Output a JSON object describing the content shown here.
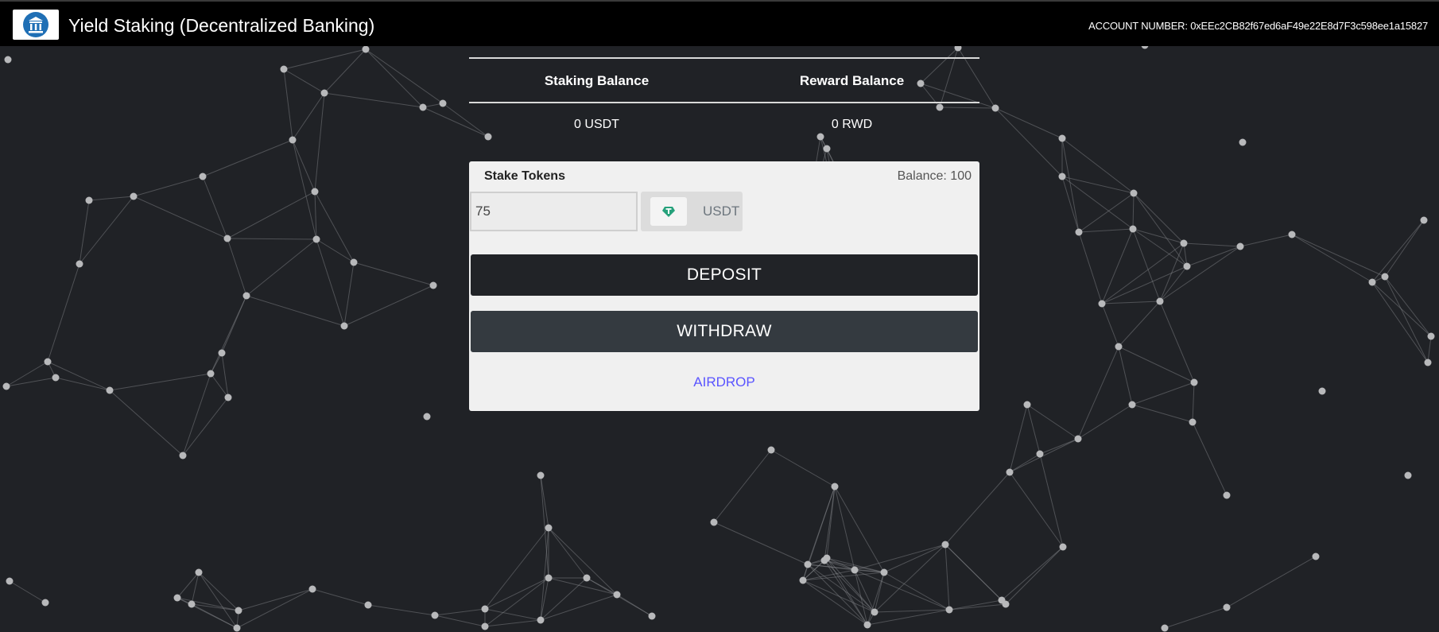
{
  "navbar": {
    "title": "Yield Staking (Decentralized Banking)",
    "account_label": "ACCOUNT NUMBER:",
    "account_number": "0xEEc2CB82f67ed6aF49e22E8d7F3c598ee1a15827",
    "logo_icon": "bank-icon"
  },
  "balances": {
    "staking_header": "Staking Balance",
    "reward_header": "Reward Balance",
    "staking_value": "0 USDT",
    "reward_value": "0 RWD"
  },
  "stake_card": {
    "label": "Stake Tokens",
    "balance_text": "Balance: 100",
    "amount_value": "75",
    "token_name": "USDT",
    "token_icon": "tether-icon",
    "deposit_label": "DEPOSIT",
    "withdraw_label": "WITHDRAW",
    "airdrop_label": "AIRDROP"
  },
  "colors": {
    "background": "#202226",
    "navbar": "#000000",
    "card": "#f0f0f0",
    "deposit_button": "#212327",
    "withdraw_button": "#343a40",
    "airdrop_link": "#5a54ff",
    "token_icon": "#26a17b"
  }
}
